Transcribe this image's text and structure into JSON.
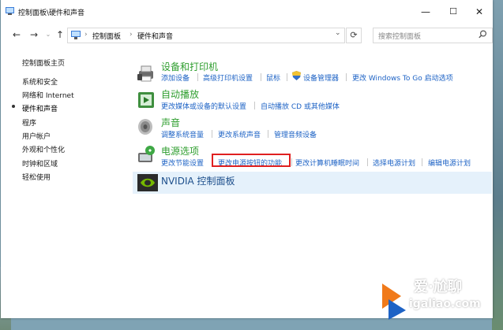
{
  "window": {
    "title": "控制面板\\硬件和声音",
    "controls": {
      "minimize": "—",
      "maximize": "☐",
      "close": "✕"
    }
  },
  "toolbar": {
    "back": "←",
    "forward": "→",
    "recent": "⌄",
    "up": "↑",
    "breadcrumb": [
      "控制面板",
      "硬件和声音"
    ],
    "search_placeholder": "搜索控制面板"
  },
  "sidebar": {
    "items": [
      {
        "label": "控制面板主页",
        "active": false
      },
      {
        "label": "系统和安全",
        "active": false
      },
      {
        "label": "网络和 Internet",
        "active": false
      },
      {
        "label": "硬件和声音",
        "active": true
      },
      {
        "label": "程序",
        "active": false
      },
      {
        "label": "用户帐户",
        "active": false
      },
      {
        "label": "外观和个性化",
        "active": false
      },
      {
        "label": "时钟和区域",
        "active": false
      },
      {
        "label": "轻松使用",
        "active": false
      }
    ]
  },
  "categories": [
    {
      "title": "设备和打印机",
      "icon": "printer-icon",
      "links": [
        "添加设备",
        "高级打印机设置",
        "鼠标",
        "设备管理器",
        "更改 Windows To Go 启动选项"
      ]
    },
    {
      "title": "自动播放",
      "icon": "autoplay-icon",
      "links": [
        "更改媒体或设备的默认设置",
        "自动播放 CD 或其他媒体"
      ]
    },
    {
      "title": "声音",
      "icon": "speaker-icon",
      "links": [
        "调整系统音量",
        "更改系统声音",
        "管理音频设备"
      ]
    },
    {
      "title": "电源选项",
      "icon": "power-options-icon",
      "links": [
        "更改节能设置",
        "更改电源按钮的功能",
        "更改计算机睡眠时间",
        "选择电源计划",
        "编辑电源计划"
      ]
    },
    {
      "title": "NVIDIA 控制面板",
      "icon": "nvidia-icon",
      "links": []
    }
  ],
  "highlighted_link": "更改电源按钮的功能",
  "watermark": {
    "brand": "爱·尬聊",
    "url": "igaliao.com"
  },
  "colors": {
    "category_title": "#2f9e2f",
    "link": "#1e63c5",
    "highlight_border": "#e02020",
    "selected_row": "#e5f1fb"
  }
}
